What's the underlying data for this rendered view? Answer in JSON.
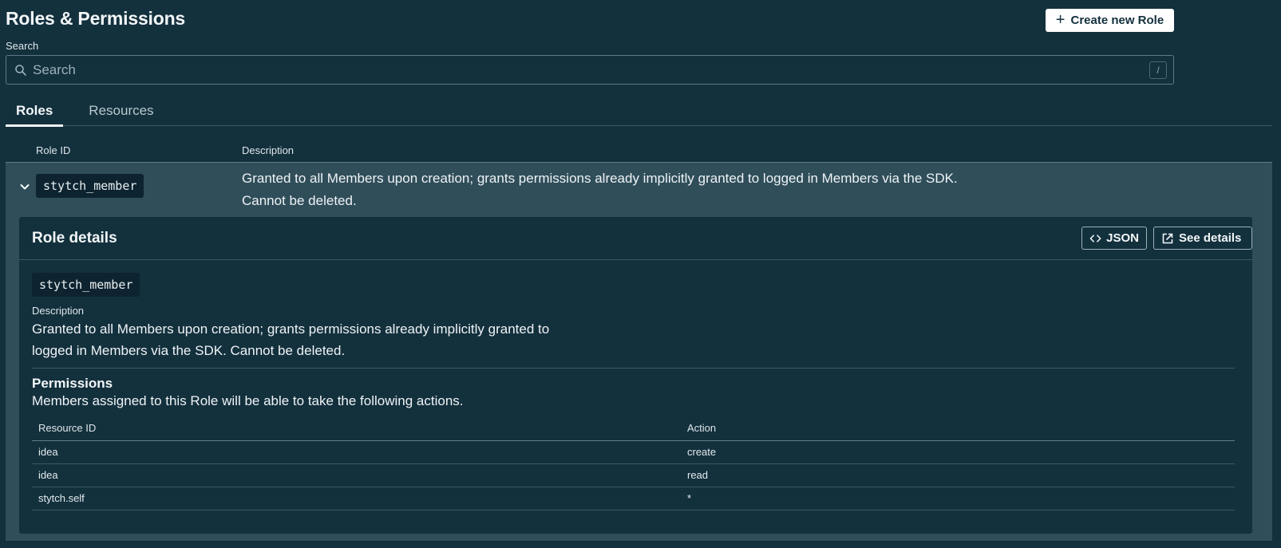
{
  "page": {
    "title": "Roles & Permissions",
    "create_button": {
      "icon": "plus-icon",
      "label": "Create new Role"
    }
  },
  "search": {
    "label": "Search",
    "placeholder": "Search",
    "value": "",
    "icon": "search-icon",
    "shortcut": "/"
  },
  "tabs": [
    {
      "label": "Roles",
      "active": true
    },
    {
      "label": "Resources",
      "active": false
    }
  ],
  "roles_table": {
    "columns": {
      "role_id": "Role ID",
      "description": "Description"
    },
    "rows": [
      {
        "expanded": true,
        "expand_icon": "chevron-down-icon",
        "role_id": "stytch_member",
        "description": "Granted to all Members upon creation; grants permissions already implicitly granted to logged in Members via the SDK. Cannot be deleted."
      }
    ]
  },
  "role_details": {
    "title": "Role details",
    "json_button": {
      "icon": "code-icon",
      "label": "JSON"
    },
    "see_details_button": {
      "icon": "external-link-icon",
      "label": "See details"
    },
    "role_id": "stytch_member",
    "description_label": "Description",
    "description": "Granted to all Members upon creation; grants permissions already implicitly granted to logged in Members via the SDK. Cannot be deleted.",
    "permissions_title": "Permissions",
    "permissions_subtitle": "Members assigned to this Role will be able to take the following actions.",
    "permissions_columns": {
      "resource_id": "Resource ID",
      "action": "Action"
    },
    "permissions": [
      {
        "resource_id": "idea",
        "action": "create"
      },
      {
        "resource_id": "idea",
        "action": "read"
      },
      {
        "resource_id": "stytch.self",
        "action": "*"
      }
    ]
  }
}
